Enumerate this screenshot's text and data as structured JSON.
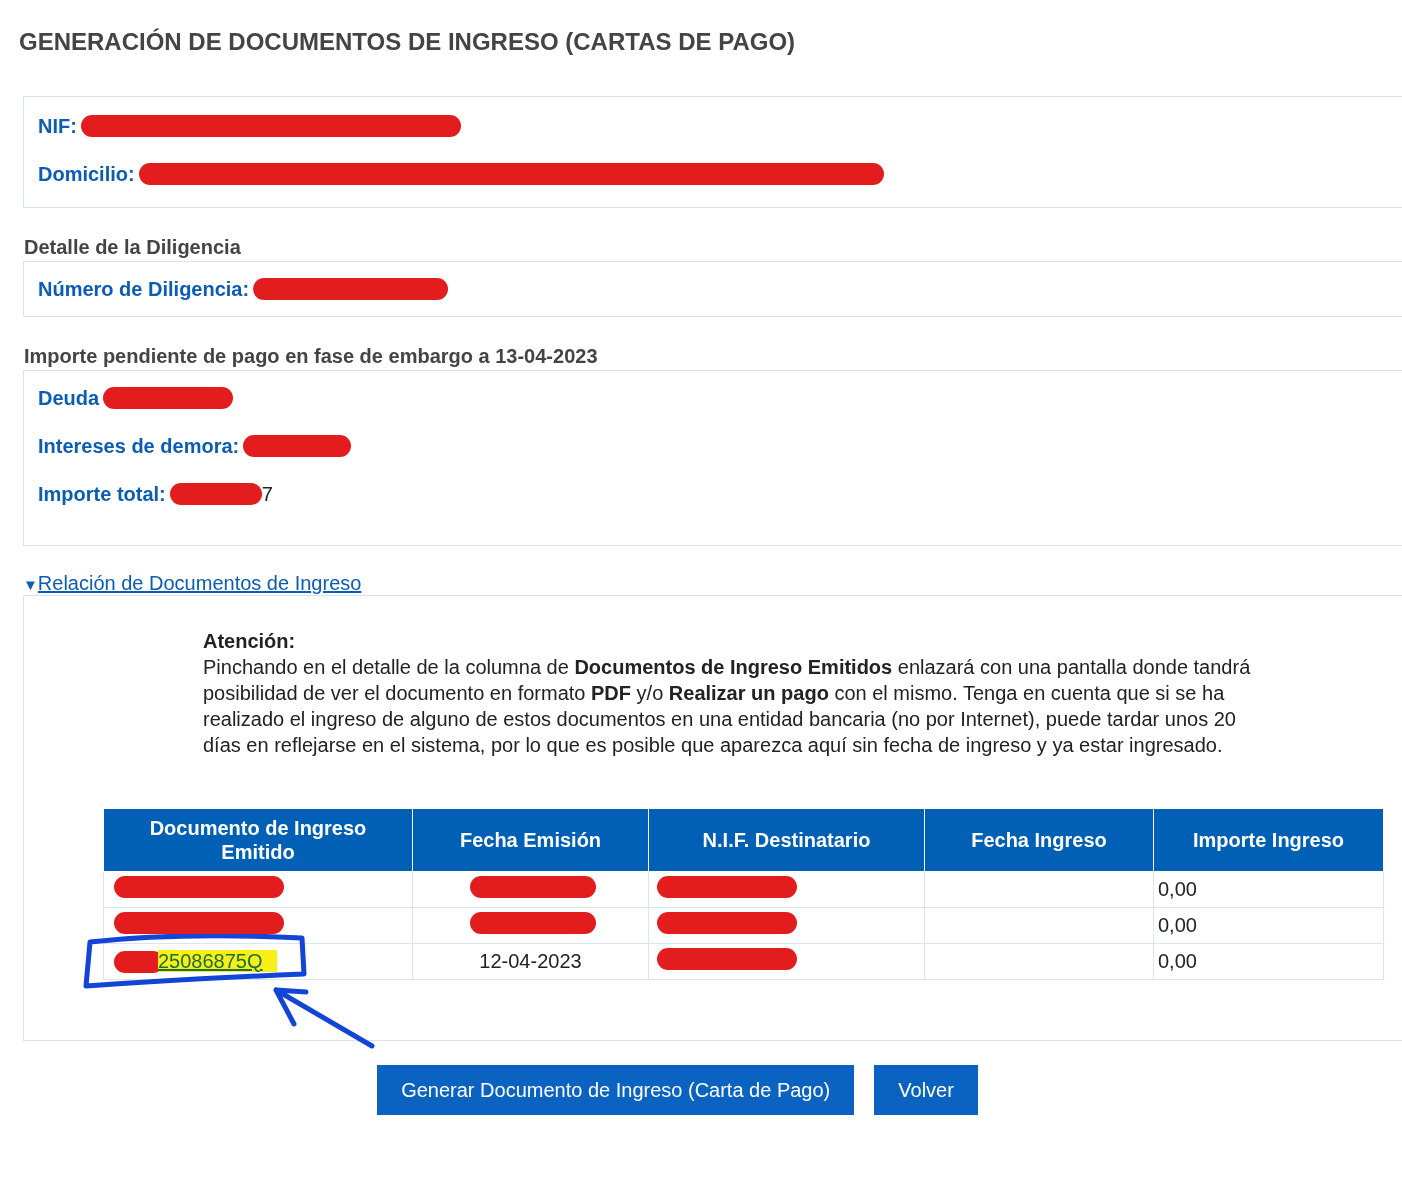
{
  "title": "GENERACIÓN DE DOCUMENTOS DE INGRESO (CARTAS DE PAGO)",
  "taxpayer": {
    "fields": [
      {
        "label": "NIF:",
        "redacted": true
      },
      {
        "label": "Domicilio:",
        "redacted": true
      }
    ]
  },
  "diligencia": {
    "heading": "Detalle de la Diligencia",
    "fields": [
      {
        "label": "Número de Diligencia:",
        "redacted": true
      }
    ]
  },
  "importe": {
    "heading": "Importe pendiente de pago en fase de embargo a 13-04-2023",
    "fields": [
      {
        "label": "Deuda",
        "redacted": true
      },
      {
        "label": "Intereses de demora:",
        "redacted": true
      },
      {
        "label": "Importe total:",
        "redacted": true,
        "value": "7"
      }
    ]
  },
  "relacion": {
    "toggle": "▼",
    "title": "Relación de Documentos de Ingreso",
    "expanded": true,
    "notice_title": "Atención:",
    "notice": "Pinchando en el detalle de la columna de **Documentos de Ingreso Emitidos** enlazará con una pantalla donde tandrá posibilidad de ver el documento en formato **PDF** y/o **Realizar un pago** con el mismo. Tenga en cuenta que si se ha realizado el ingreso de alguno de estos documentos en una entidad bancaria (no por Internet), puede tardar unos 20 días en reflejarse en el sistema, por lo que es posible que aparezca aquí sin fecha de ingreso y ya estar ingresado.",
    "table": {
      "columns": [
        "Documento de Ingreso Emitido",
        "Fecha Emisión",
        "N.I.F. Destinatario",
        "Fecha Ingreso",
        "Importe Ingreso"
      ],
      "rows": [
        {
          "document": {
            "redacted": true
          },
          "fecha_emision": {
            "redacted": true
          },
          "nif": {
            "redacted": true
          },
          "importe": "0,00"
        },
        {
          "document": {
            "redacted": true
          },
          "fecha_emision": {
            "redacted": true
          },
          "nif": {
            "redacted": true
          },
          "importe": "0,00"
        },
        {
          "document": {
            "redacted": true,
            "value": "25086875Q",
            "highlighted": true,
            "circled": true
          },
          "fecha_emision": {
            "redacted": false,
            "value": "12-04-2023"
          },
          "nif": {
            "redacted": true
          },
          "importe": "0,00"
        }
      ]
    }
  },
  "buttons": [
    "Generar Documento de Ingreso (Carta de Pago)",
    "Volver"
  ]
}
